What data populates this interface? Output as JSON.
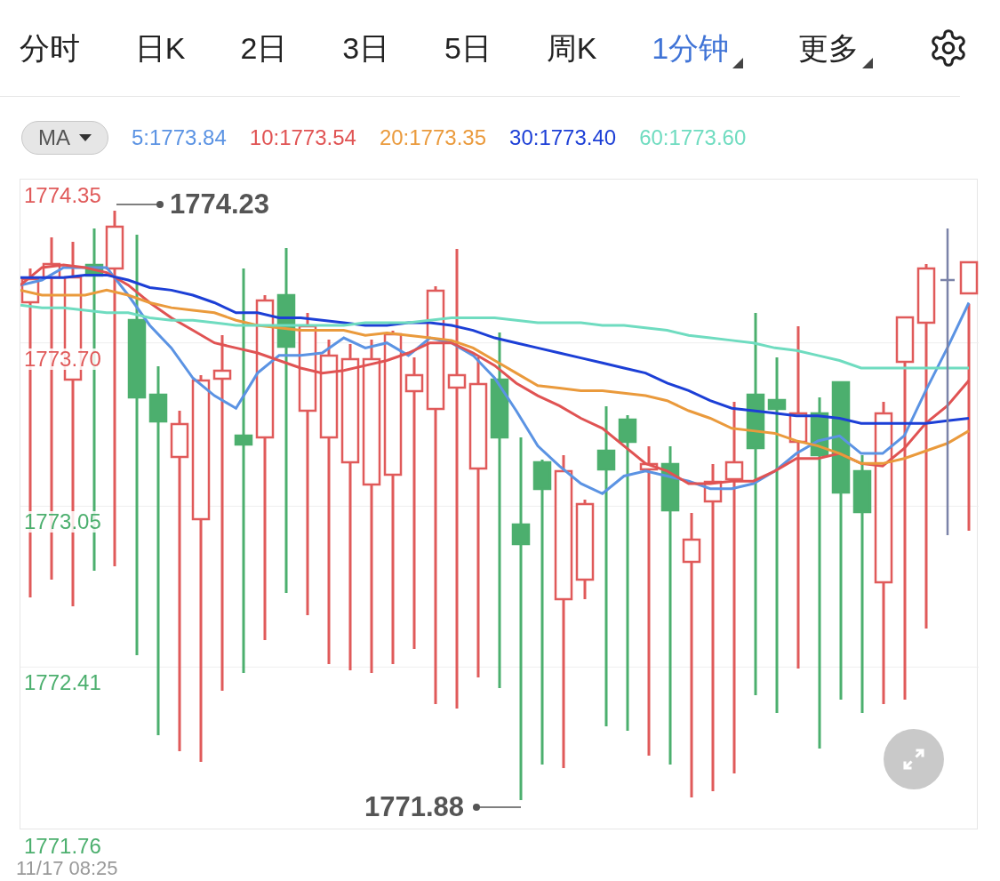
{
  "tabs": [
    {
      "label": "分时",
      "selected": false,
      "has_menu": false
    },
    {
      "label": "日K",
      "selected": false,
      "has_menu": false
    },
    {
      "label": "2日",
      "selected": false,
      "has_menu": false
    },
    {
      "label": "3日",
      "selected": false,
      "has_menu": false
    },
    {
      "label": "5日",
      "selected": false,
      "has_menu": false
    },
    {
      "label": "周K",
      "selected": false,
      "has_menu": false
    },
    {
      "label": "1分钟",
      "selected": true,
      "has_menu": true
    },
    {
      "label": "更多",
      "selected": false,
      "has_menu": true
    }
  ],
  "indicator": {
    "label": "MA",
    "items": [
      "5:1773.84",
      "10:1773.54",
      "20:1773.35",
      "30:1773.40",
      "60:1773.60"
    ]
  },
  "chart": {
    "chart_data": {
      "type": "line",
      "grid": true,
      "ylim": [
        1771.76,
        1774.35
      ],
      "yticks": [
        {
          "value": 1774.35,
          "label": "1774.35"
        },
        {
          "value": 1773.7,
          "label": "1773.70"
        },
        {
          "value": 1773.05,
          "label": "1773.05"
        },
        {
          "value": 1772.41,
          "label": "1772.41"
        },
        {
          "value": 1771.76,
          "label": "1771.76"
        }
      ],
      "series": [
        {
          "color": "#5b93e3",
          "values": [
            1773.93,
            1773.95,
            1774.0,
            1774.0,
            1774.0,
            1773.89,
            1773.77,
            1773.68,
            1773.56,
            1773.49,
            1773.44,
            1773.58,
            1773.65,
            1773.65,
            1773.66,
            1773.72,
            1773.68,
            1773.7,
            1773.65,
            1773.72,
            1773.7,
            1773.65,
            1773.56,
            1773.43,
            1773.29,
            1773.21,
            1773.14,
            1773.1,
            1773.17,
            1773.19,
            1773.17,
            1773.15,
            1773.12,
            1773.12,
            1773.14,
            1773.19,
            1773.26,
            1773.31,
            1773.33,
            1773.26,
            1773.26,
            1773.33,
            1773.51,
            1773.68,
            1773.86
          ]
        },
        {
          "color": "#e05353",
          "values": [
            1773.93,
            1774.0,
            1774.01,
            1774.0,
            1773.98,
            1773.93,
            1773.86,
            1773.8,
            1773.75,
            1773.7,
            1773.68,
            1773.66,
            1773.63,
            1773.6,
            1773.58,
            1773.59,
            1773.61,
            1773.63,
            1773.66,
            1773.7,
            1773.7,
            1773.66,
            1773.61,
            1773.54,
            1773.49,
            1773.45,
            1773.4,
            1773.36,
            1773.29,
            1773.22,
            1773.19,
            1773.14,
            1773.14,
            1773.15,
            1773.15,
            1773.19,
            1773.24,
            1773.24,
            1773.26,
            1773.22,
            1773.21,
            1773.28,
            1773.38,
            1773.45,
            1773.55
          ]
        },
        {
          "color": "#ea9a3c",
          "values": [
            1773.91,
            1773.89,
            1773.89,
            1773.89,
            1773.91,
            1773.89,
            1773.86,
            1773.84,
            1773.83,
            1773.82,
            1773.79,
            1773.77,
            1773.76,
            1773.75,
            1773.75,
            1773.75,
            1773.73,
            1773.74,
            1773.73,
            1773.72,
            1773.71,
            1773.68,
            1773.63,
            1773.58,
            1773.53,
            1773.52,
            1773.51,
            1773.51,
            1773.5,
            1773.49,
            1773.47,
            1773.43,
            1773.4,
            1773.36,
            1773.35,
            1773.34,
            1773.31,
            1773.29,
            1773.26,
            1773.22,
            1773.22,
            1773.24,
            1773.27,
            1773.3,
            1773.35
          ]
        },
        {
          "color": "#1c3fd6",
          "values": [
            1773.96,
            1773.96,
            1773.96,
            1773.97,
            1773.97,
            1773.95,
            1773.92,
            1773.91,
            1773.89,
            1773.86,
            1773.82,
            1773.82,
            1773.8,
            1773.8,
            1773.79,
            1773.78,
            1773.77,
            1773.77,
            1773.78,
            1773.78,
            1773.77,
            1773.75,
            1773.72,
            1773.7,
            1773.68,
            1773.66,
            1773.64,
            1773.62,
            1773.6,
            1773.58,
            1773.54,
            1773.51,
            1773.47,
            1773.44,
            1773.43,
            1773.42,
            1773.41,
            1773.41,
            1773.4,
            1773.38,
            1773.38,
            1773.38,
            1773.38,
            1773.39,
            1773.4
          ]
        },
        {
          "color": "#6fdcc0",
          "values": [
            1773.85,
            1773.84,
            1773.84,
            1773.83,
            1773.82,
            1773.82,
            1773.8,
            1773.79,
            1773.79,
            1773.78,
            1773.77,
            1773.77,
            1773.77,
            1773.77,
            1773.77,
            1773.77,
            1773.78,
            1773.78,
            1773.78,
            1773.79,
            1773.8,
            1773.8,
            1773.8,
            1773.79,
            1773.78,
            1773.78,
            1773.78,
            1773.77,
            1773.77,
            1773.76,
            1773.75,
            1773.73,
            1773.72,
            1773.71,
            1773.7,
            1773.68,
            1773.67,
            1773.65,
            1773.63,
            1773.6,
            1773.6,
            1773.6,
            1773.6,
            1773.6,
            1773.6
          ]
        }
      ]
    },
    "high_label": "1774.23",
    "low_label": "1771.88"
  },
  "timestamp": "11/17 08:25"
}
